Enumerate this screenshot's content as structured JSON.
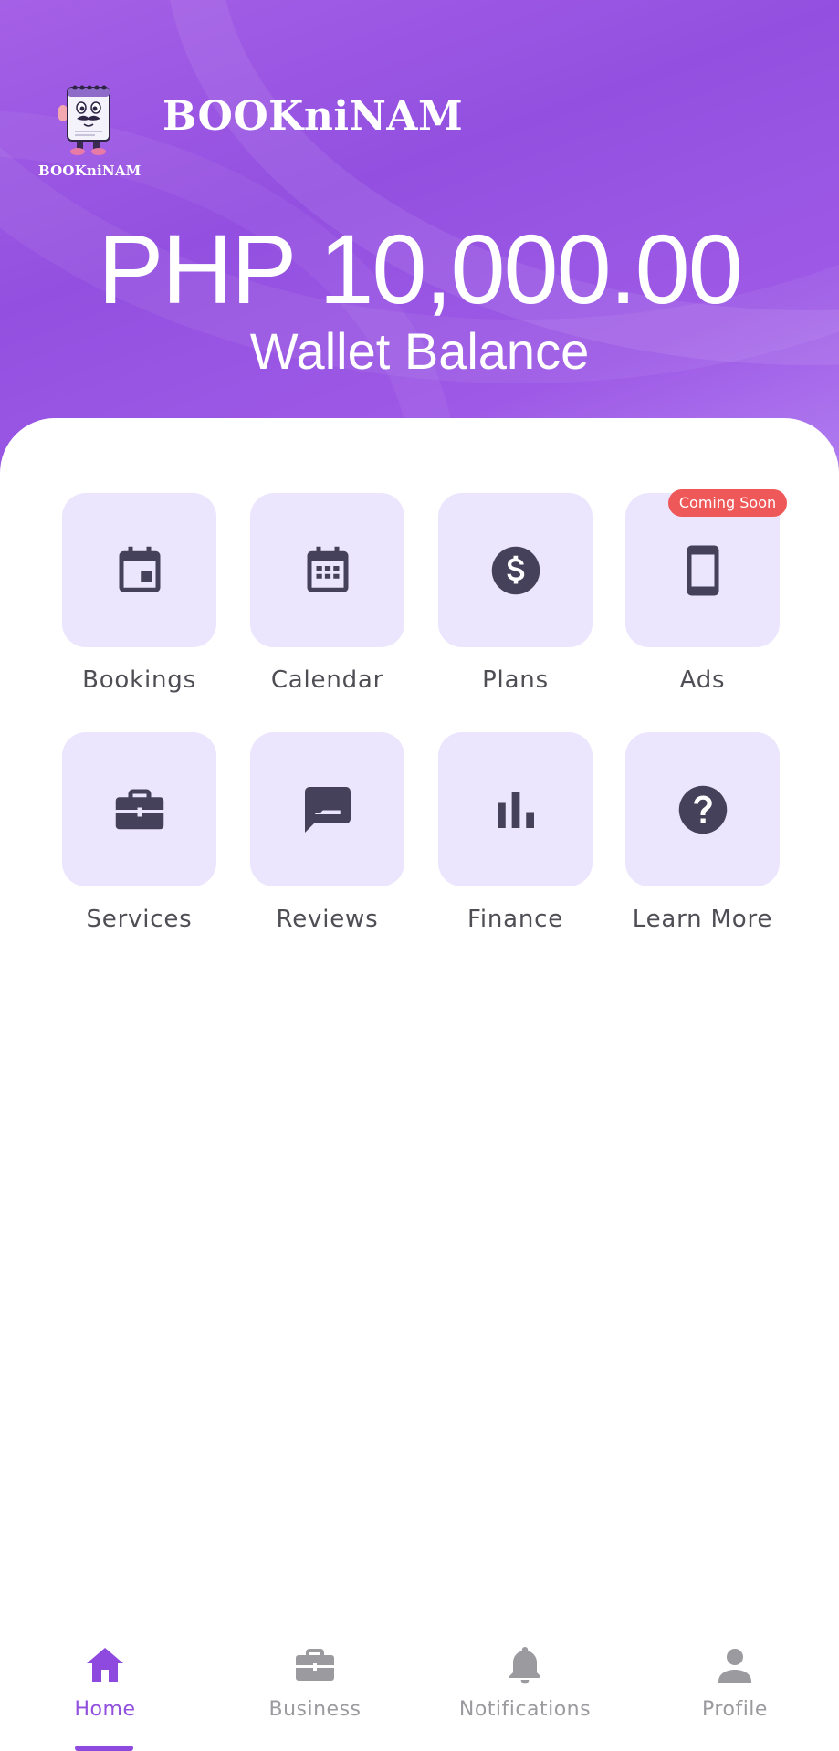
{
  "brand": {
    "name": "BOOKniNAM",
    "logo_caption": "BOOKniNAM"
  },
  "wallet": {
    "balance": "PHP 10,000.00",
    "label": "Wallet Balance"
  },
  "colors": {
    "header_gradient": "#9b57e4",
    "tile_background": "#ebe5fd",
    "icon": "#45415a",
    "badge": "#ee5858",
    "nav_active": "#9150dd",
    "nav_inactive": "#9a9a9f"
  },
  "menu": {
    "items": [
      {
        "label": "Bookings",
        "icon": "calendar-event-icon"
      },
      {
        "label": "Calendar",
        "icon": "calendar-month-icon"
      },
      {
        "label": "Plans",
        "icon": "dollar-circle-icon"
      },
      {
        "label": "Ads",
        "icon": "phone-icon",
        "badge": "Coming Soon"
      },
      {
        "label": "Services",
        "icon": "briefcase-icon"
      },
      {
        "label": "Reviews",
        "icon": "rate-review-icon"
      },
      {
        "label": "Finance",
        "icon": "bar-chart-icon"
      },
      {
        "label": "Learn More",
        "icon": "help-circle-icon"
      }
    ]
  },
  "nav": {
    "items": [
      {
        "label": "Home",
        "icon": "home-icon",
        "active": true
      },
      {
        "label": "Business",
        "icon": "briefcase-icon",
        "active": false
      },
      {
        "label": "Notifications",
        "icon": "bell-icon",
        "active": false
      },
      {
        "label": "Profile",
        "icon": "person-icon",
        "active": false
      }
    ]
  }
}
